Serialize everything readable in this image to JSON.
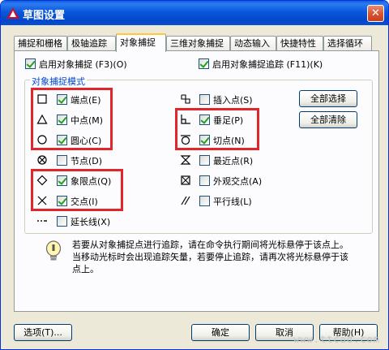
{
  "window": {
    "title": "草图设置",
    "close_glyph": "✕"
  },
  "tabs": [
    {
      "label": "捕捉和栅格",
      "active": false
    },
    {
      "label": "极轴追踪",
      "active": false
    },
    {
      "label": "对象捕捉",
      "active": true
    },
    {
      "label": "三维对象捕捉",
      "active": false
    },
    {
      "label": "动态输入",
      "active": false
    },
    {
      "label": "快捷特性",
      "active": false
    },
    {
      "label": "选择循环",
      "active": false
    }
  ],
  "enable_snap": {
    "label": "启用对象捕捉 (F3)(O)",
    "checked": true
  },
  "enable_tracking": {
    "label": "启用对象捕捉追踪 (F11)(K)",
    "checked": true
  },
  "snap_modes": {
    "title": "对象捕捉模式",
    "left": [
      {
        "label": "端点(E)",
        "checked": true,
        "icon": "square-icon"
      },
      {
        "label": "中点(M)",
        "checked": true,
        "icon": "triangle-icon"
      },
      {
        "label": "圆心(C)",
        "checked": true,
        "icon": "circle-icon"
      },
      {
        "label": "节点(D)",
        "checked": false,
        "icon": "node-icon"
      },
      {
        "label": "象限点(Q)",
        "checked": true,
        "icon": "diamond-icon"
      },
      {
        "label": "交点(I)",
        "checked": true,
        "icon": "cross-icon"
      },
      {
        "label": "延长线(X)",
        "checked": false,
        "icon": "extension-icon"
      }
    ],
    "right": [
      {
        "label": "插入点(S)",
        "checked": false,
        "icon": "insert-icon"
      },
      {
        "label": "垂足(P)",
        "checked": true,
        "icon": "perpendicular-icon"
      },
      {
        "label": "切点(N)",
        "checked": true,
        "icon": "tangent-icon"
      },
      {
        "label": "最近点(R)",
        "checked": false,
        "icon": "nearest-icon"
      },
      {
        "label": "外观交点(A)",
        "checked": false,
        "icon": "apparent-intersection-icon"
      },
      {
        "label": "平行线(L)",
        "checked": false,
        "icon": "parallel-icon"
      }
    ],
    "select_all": "全部选择",
    "clear_all": "全部清除"
  },
  "info_text": "若要从对象捕捉点进行追踪，请在命令执行期间将光标悬停于该点上。当移动光标时会出现追踪矢量，若要停止追踪，请再次将光标悬停于该点上。",
  "footer": {
    "options": "选项(T)...",
    "ok": "确定",
    "cancel": "取消",
    "help": "帮助(H)"
  },
  "watermark": "www.ttcad.com",
  "colors": {
    "highlight": "#e0262a",
    "group_title": "#0046d5",
    "titlebar": "#0b58dc"
  }
}
